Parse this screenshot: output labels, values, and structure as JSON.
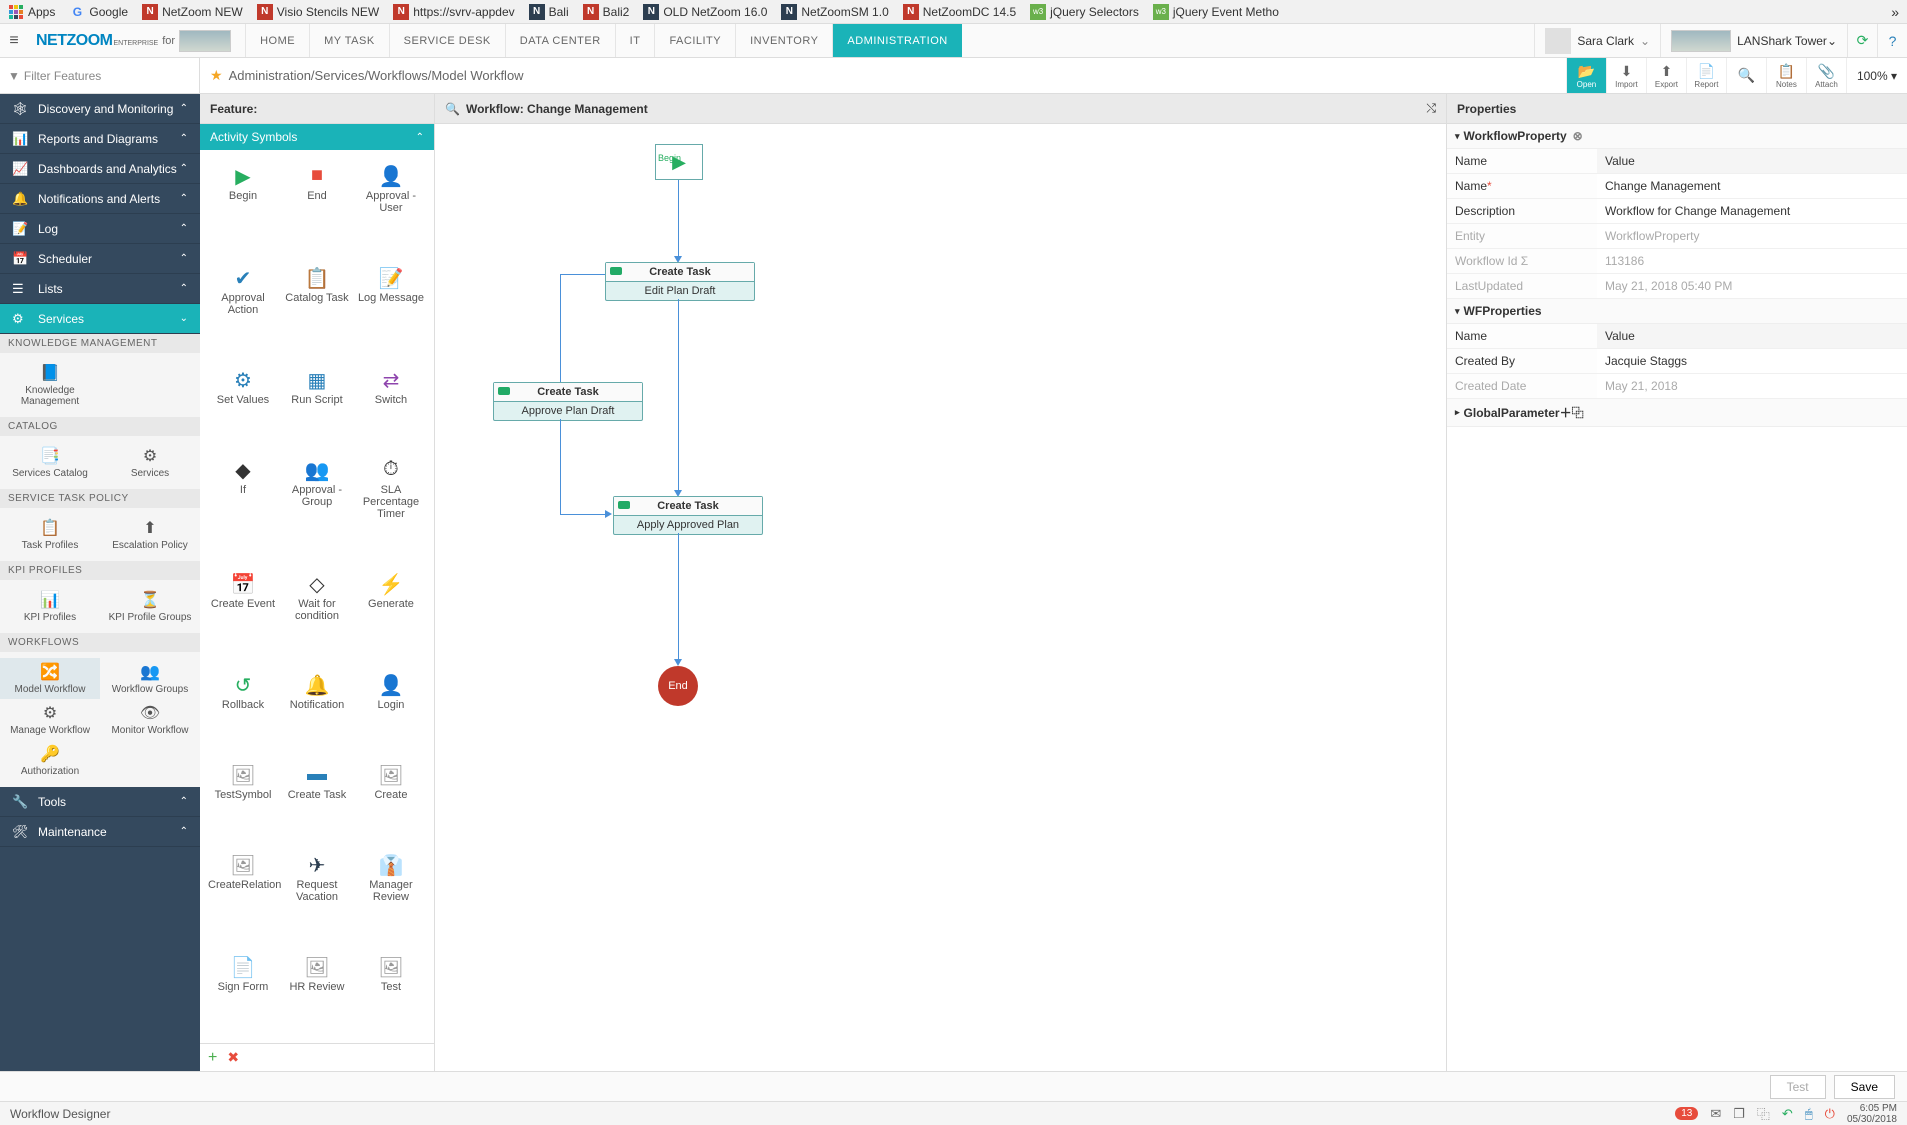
{
  "browser_tabs": [
    {
      "icon_color": "#4285f4",
      "label": "Apps"
    },
    {
      "icon_color": "#4285f4",
      "label": "Google",
      "g": true
    },
    {
      "icon_color": "#c0392b",
      "label": "NetZoom NEW"
    },
    {
      "icon_color": "#c0392b",
      "label": "Visio Stencils NEW"
    },
    {
      "icon_color": "#c0392b",
      "label": "https://svrv-appdev"
    },
    {
      "icon_color": "#2c3e50",
      "label": "Bali"
    },
    {
      "icon_color": "#c0392b",
      "label": "Bali2"
    },
    {
      "icon_color": "#2c3e50",
      "label": "OLD NetZoom 16.0"
    },
    {
      "icon_color": "#2c3e50",
      "label": "NetZoomSM 1.0"
    },
    {
      "icon_color": "#c0392b",
      "label": "NetZoomDC 14.5"
    },
    {
      "icon_color": "#6ab04c",
      "label": "jQuery Selectors"
    },
    {
      "icon_color": "#6ab04c",
      "label": "jQuery Event Metho"
    }
  ],
  "logo": {
    "brand": "NETZOOM",
    "sub": "ENTERPRISE",
    "for": "for"
  },
  "main_tabs": [
    "HOME",
    "MY TASK",
    "SERVICE DESK",
    "DATA CENTER",
    "IT",
    "FACILITY",
    "INVENTORY",
    "ADMINISTRATION"
  ],
  "main_tabs_active": 7,
  "user": {
    "name": "Sara Clark"
  },
  "location": {
    "name": "LANShark Tower"
  },
  "filter_placeholder": "Filter Features",
  "breadcrumb": "Administration/Services/Workflows/Model Workflow",
  "sec_actions": [
    {
      "label": "Open",
      "icon": "📂",
      "active": true
    },
    {
      "label": "Import",
      "icon": "⬇"
    },
    {
      "label": "Export",
      "icon": "⬆"
    },
    {
      "label": "Report",
      "icon": "📄"
    }
  ],
  "sec_icons": [
    {
      "name": "search-icon",
      "glyph": "🔍"
    },
    {
      "name": "notes-icon",
      "glyph": "📋",
      "label": "Notes"
    },
    {
      "name": "attach-icon",
      "glyph": "📎",
      "label": "Attach"
    }
  ],
  "zoom": "100%",
  "sidebar_items": [
    {
      "icon": "🕸",
      "label": "Discovery and Monitoring"
    },
    {
      "icon": "📊",
      "label": "Reports and Diagrams"
    },
    {
      "icon": "📈",
      "label": "Dashboards and Analytics"
    },
    {
      "icon": "🔔",
      "label": "Notifications and Alerts"
    },
    {
      "icon": "📝",
      "label": "Log"
    },
    {
      "icon": "📅",
      "label": "Scheduler"
    },
    {
      "icon": "☰",
      "label": "Lists"
    },
    {
      "icon": "⚙",
      "label": "Services",
      "active": true,
      "down": true
    }
  ],
  "sb_sections": [
    {
      "title": "KNOWLEDGE MANAGEMENT",
      "items": [
        {
          "icon": "📘",
          "label": "Knowledge Management"
        }
      ]
    },
    {
      "title": "CATALOG",
      "items": [
        {
          "icon": "📑",
          "label": "Services Catalog"
        },
        {
          "icon": "⚙",
          "label": "Services"
        }
      ]
    },
    {
      "title": "SERVICE TASK POLICY",
      "items": [
        {
          "icon": "📋",
          "label": "Task Profiles"
        },
        {
          "icon": "⬆",
          "label": "Escalation Policy"
        }
      ]
    },
    {
      "title": "KPI PROFILES",
      "items": [
        {
          "icon": "📊",
          "label": "KPI Profiles"
        },
        {
          "icon": "⏳",
          "label": "KPI Profile Groups"
        }
      ]
    },
    {
      "title": "WORKFLOWS",
      "items": [
        {
          "icon": "🔀",
          "label": "Model Workflow",
          "sel": true
        },
        {
          "icon": "👥",
          "label": "Workflow Groups"
        },
        {
          "icon": "⚙",
          "label": "Manage Workflow"
        },
        {
          "icon": "👁",
          "label": "Monitor Workflow"
        },
        {
          "icon": "🔑",
          "label": "Authorization"
        }
      ]
    }
  ],
  "sidebar_bottom": [
    {
      "icon": "🔧",
      "label": "Tools"
    },
    {
      "icon": "🛠",
      "label": "Maintenance"
    }
  ],
  "feature_header": "Feature:",
  "activity_header": "Activity Symbols",
  "activity_symbols": [
    {
      "icon": "▶",
      "color": "#27ae60",
      "label": "Begin"
    },
    {
      "icon": "■",
      "color": "#e74c3c",
      "label": "End"
    },
    {
      "icon": "👤",
      "color": "#27ae60",
      "label": "Approval - User"
    },
    {
      "icon": "✔",
      "color": "#2980b9",
      "label": "Approval Action"
    },
    {
      "icon": "📋",
      "color": "#2980b9",
      "label": "Catalog Task"
    },
    {
      "icon": "📝",
      "color": "#e67e22",
      "label": "Log Message"
    },
    {
      "icon": "⚙",
      "color": "#2980b9",
      "label": "Set Values"
    },
    {
      "icon": "▦",
      "color": "#2980b9",
      "label": "Run Script"
    },
    {
      "icon": "⇄",
      "color": "#8e44ad",
      "label": "Switch"
    },
    {
      "icon": "◆",
      "color": "#333",
      "label": "If"
    },
    {
      "icon": "👥",
      "color": "#27ae60",
      "label": "Approval - Group"
    },
    {
      "icon": "⏱",
      "color": "#333",
      "label": "SLA Percentage Timer"
    },
    {
      "icon": "📅",
      "color": "#2980b9",
      "label": "Create Event"
    },
    {
      "icon": "◇",
      "color": "#333",
      "label": "Wait for condition"
    },
    {
      "icon": "⚡",
      "color": "#2980b9",
      "label": "Generate"
    },
    {
      "icon": "↺",
      "color": "#27ae60",
      "label": "Rollback"
    },
    {
      "icon": "🔔",
      "color": "#f1c40f",
      "label": "Notification"
    },
    {
      "icon": "👤",
      "color": "#8e44ad",
      "label": "Login"
    },
    {
      "icon": "🖼",
      "color": "#999",
      "label": "TestSymbol"
    },
    {
      "icon": "▬",
      "color": "#2980b9",
      "label": "Create Task"
    },
    {
      "icon": "🖼",
      "color": "#999",
      "label": "Create"
    },
    {
      "icon": "🖼",
      "color": "#999",
      "label": "CreateRelation"
    },
    {
      "icon": "✈",
      "color": "#2c3e50",
      "label": "Request Vacation"
    },
    {
      "icon": "👔",
      "color": "#2c3e50",
      "label": "Manager Review"
    },
    {
      "icon": "📄",
      "color": "#555",
      "label": "Sign Form"
    },
    {
      "icon": "🖼",
      "color": "#999",
      "label": "HR Review"
    },
    {
      "icon": "🖼",
      "color": "#999",
      "label": "Test"
    }
  ],
  "workflow": {
    "title": "Workflow: Change Management",
    "begin": "Begin",
    "end": "End",
    "nodes": [
      {
        "title": "Create Task",
        "body": "Edit Plan Draft"
      },
      {
        "title": "Create Task",
        "body": "Approve Plan Draft"
      },
      {
        "title": "Create Task",
        "body": "Apply Approved Plan"
      }
    ]
  },
  "properties": {
    "title": "Properties",
    "sections": [
      {
        "name": "WorkflowProperty",
        "closable": true,
        "rows": [
          {
            "n": "Name",
            "v": "Value",
            "hdr": true
          },
          {
            "n": "Name*",
            "v": "Change Management",
            "req": true
          },
          {
            "n": "Description",
            "v": "Workflow for Change Management"
          },
          {
            "n": "Entity",
            "v": "WorkflowProperty",
            "disabled": true
          },
          {
            "n": "Workflow Id Σ",
            "v": "113186",
            "disabled": true
          },
          {
            "n": "LastUpdated",
            "v": "May 21, 2018 05:40 PM",
            "disabled": true
          }
        ]
      },
      {
        "name": "WFProperties",
        "rows": [
          {
            "n": "Name",
            "v": "Value",
            "hdr": true
          },
          {
            "n": "Created By",
            "v": "Jacquie Staggs"
          },
          {
            "n": "Created Date",
            "v": "May 21, 2018",
            "disabled": true
          }
        ]
      },
      {
        "name": "GlobalParameter",
        "add": true,
        "collapsed": true
      }
    ]
  },
  "buttons": {
    "test": "Test",
    "save": "Save"
  },
  "status": {
    "title": "Workflow Designer",
    "badge": "13",
    "time": "6:05 PM",
    "date": "05/30/2018"
  }
}
